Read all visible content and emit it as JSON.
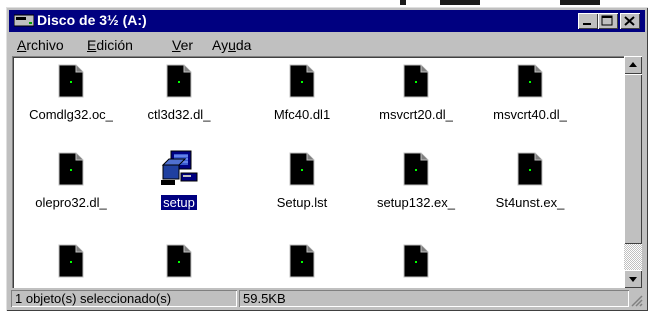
{
  "window": {
    "title": "Disco de 3½ (A:)",
    "icon": "floppy-drive-icon",
    "controls": [
      "minimize",
      "maximize",
      "close"
    ]
  },
  "menu": {
    "items": [
      {
        "accel": "A",
        "rest": "rchivo"
      },
      {
        "accel": "E",
        "rest": "dición"
      },
      {
        "accel": "V",
        "rest": "er"
      },
      {
        "pre": "Ay",
        "accel": "u",
        "rest": "da"
      }
    ]
  },
  "files": [
    {
      "label": "Comdlg32.oc_",
      "icon": "file-icon"
    },
    {
      "label": "ctl3d32.dl_",
      "icon": "file-icon"
    },
    {
      "label": "Mfc40.dl1",
      "icon": "file-icon"
    },
    {
      "label": "msvcrt20.dl_",
      "icon": "file-icon"
    },
    {
      "label": "msvcrt40.dl_",
      "icon": "file-icon"
    },
    {
      "label": "olepro32.dl_",
      "icon": "file-icon"
    },
    {
      "label": "setup",
      "icon": "setup-program-icon",
      "selected": true
    },
    {
      "label": "Setup.lst",
      "icon": "file-icon"
    },
    {
      "label": "setup132.ex_",
      "icon": "file-icon"
    },
    {
      "label": "St4unst.ex_",
      "icon": "file-icon"
    },
    {
      "label": "",
      "icon": "file-icon"
    },
    {
      "label": "",
      "icon": "file-icon"
    },
    {
      "label": "",
      "icon": "file-icon"
    },
    {
      "label": "",
      "icon": "file-icon"
    }
  ],
  "status": {
    "selection": "1 objeto(s) seleccionado(s)",
    "size": "59.5KB"
  }
}
